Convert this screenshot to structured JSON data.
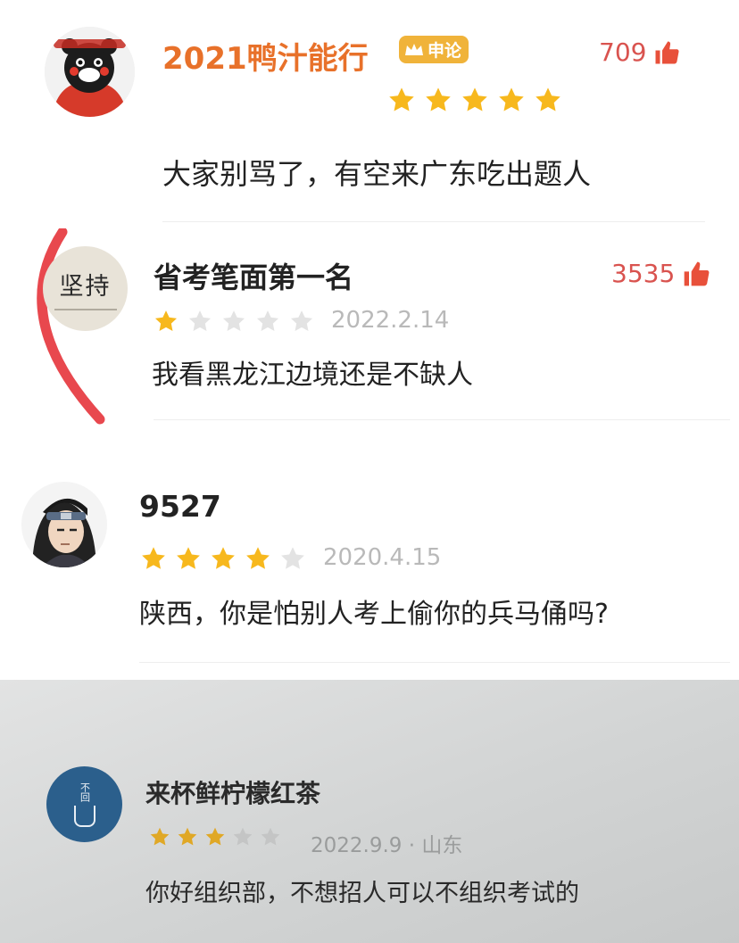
{
  "reviews": [
    {
      "username": "2021鸭汁能行",
      "badge": "申论",
      "likes": "709",
      "rating": 5,
      "comment": "大家别骂了，有空来广东吃出题人",
      "avatar": "kumamon-avatar"
    },
    {
      "username": "省考笔面第一名",
      "avatar_text": "坚持",
      "likes": "3535",
      "rating": 1,
      "date": "2022.2.14",
      "comment": "我看黑龙江边境还是不缺人"
    },
    {
      "username": "9527",
      "rating": 4,
      "date": "2020.4.15",
      "comment": "陕西，你是怕别人考上偷你的兵马俑吗?",
      "avatar": "anime-character-avatar"
    },
    {
      "username": "来杯鲜柠檬红茶",
      "rating": 3,
      "date": "2022.9.9 · 山东",
      "comment": "你好组织部，不想招人可以不组织考试的",
      "avatar_text": "不回"
    }
  ],
  "icons": {
    "like": "thumbs-up-icon",
    "badge": "crown-icon",
    "star": "star-icon"
  },
  "colors": {
    "star_filled": "#f7b81d",
    "star_empty": "#e3e3e3",
    "likes": "#d9534f",
    "username_orange": "#e8712a",
    "badge": "#f0b33a",
    "swipe_arc": "#e8484e"
  }
}
